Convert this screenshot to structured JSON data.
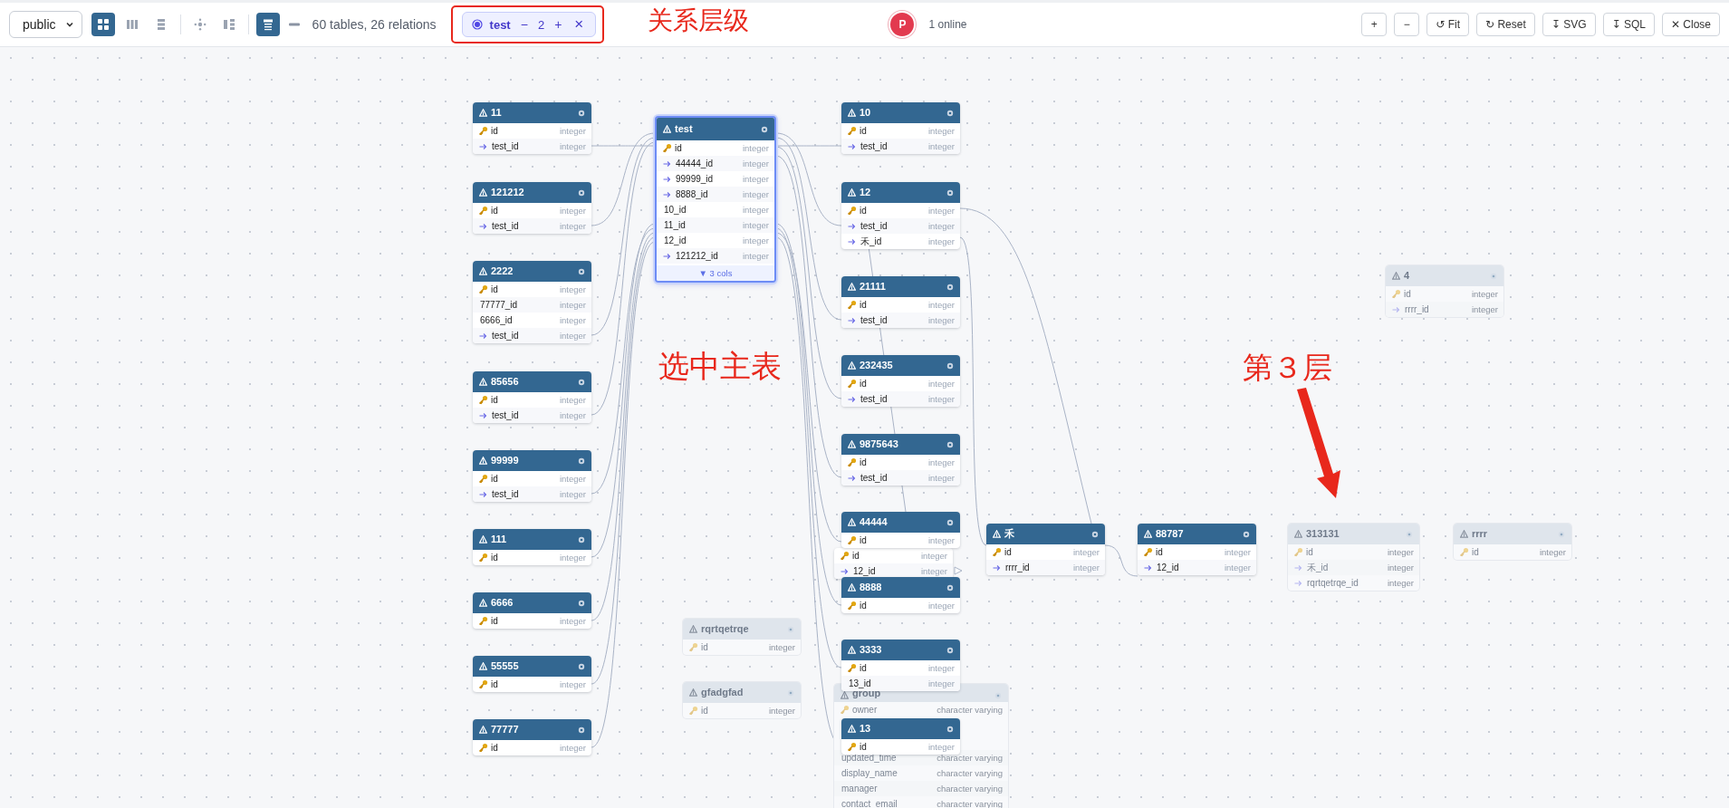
{
  "toolbar": {
    "schema": "public",
    "view_buttons": [
      {
        "kind": "grid",
        "selected": true
      },
      {
        "kind": "columns",
        "selected": false
      },
      {
        "kind": "rows",
        "selected": false
      },
      {
        "kind": "radial",
        "selected": false
      },
      {
        "kind": "tree",
        "selected": false
      }
    ],
    "focus_toggle": {
      "on": true
    },
    "summary": "60 tables, 26 relations",
    "focus_chip": {
      "table": "test",
      "minus": "−",
      "depth": "2",
      "plus": "+",
      "close": "×"
    },
    "presence": {
      "avatar": "P",
      "label": "1 online"
    },
    "actions": [
      "+",
      "−",
      "↺ Fit",
      "↻ Reset",
      "↧ SVG",
      "↧ SQL",
      "✕ Close"
    ]
  },
  "tables": [
    {
      "name": "11",
      "dimmed": false,
      "selected": false,
      "columns": [
        {
          "name": "id",
          "type": "integer",
          "kind": "pk"
        },
        {
          "name": "test_id",
          "type": "integer",
          "kind": "fk"
        }
      ]
    },
    {
      "name": "121212",
      "dimmed": false,
      "selected": false,
      "columns": [
        {
          "name": "id",
          "type": "integer",
          "kind": "pk"
        },
        {
          "name": "test_id",
          "type": "integer",
          "kind": "fk"
        }
      ]
    },
    {
      "name": "2222",
      "dimmed": false,
      "selected": false,
      "columns": [
        {
          "name": "id",
          "type": "integer",
          "kind": "pk"
        },
        {
          "name": "77777_id",
          "type": "integer",
          "kind": "plain"
        },
        {
          "name": "6666_id",
          "type": "integer",
          "kind": "plain"
        },
        {
          "name": "test_id",
          "type": "integer",
          "kind": "fk"
        }
      ]
    },
    {
      "name": "85656",
      "dimmed": false,
      "selected": false,
      "columns": [
        {
          "name": "id",
          "type": "integer",
          "kind": "pk"
        },
        {
          "name": "test_id",
          "type": "integer",
          "kind": "fk"
        }
      ]
    },
    {
      "name": "99999",
      "dimmed": false,
      "selected": false,
      "columns": [
        {
          "name": "id",
          "type": "integer",
          "kind": "pk"
        },
        {
          "name": "test_id",
          "type": "integer",
          "kind": "fk"
        }
      ]
    },
    {
      "name": "111",
      "dimmed": false,
      "selected": false,
      "columns": [
        {
          "name": "id",
          "type": "integer",
          "kind": "pk"
        }
      ]
    },
    {
      "name": "6666",
      "dimmed": false,
      "selected": false,
      "columns": [
        {
          "name": "id",
          "type": "integer",
          "kind": "pk"
        }
      ]
    },
    {
      "name": "55555",
      "dimmed": false,
      "selected": false,
      "columns": [
        {
          "name": "id",
          "type": "integer",
          "kind": "pk"
        }
      ]
    },
    {
      "name": "77777",
      "dimmed": false,
      "selected": false,
      "columns": [
        {
          "name": "id",
          "type": "integer",
          "kind": "pk"
        }
      ]
    },
    {
      "name": "test",
      "dimmed": false,
      "selected": true,
      "columns": [
        {
          "name": "id",
          "type": "integer",
          "kind": "pk"
        },
        {
          "name": "44444_id",
          "type": "integer",
          "kind": "fk"
        },
        {
          "name": "99999_id",
          "type": "integer",
          "kind": "fk"
        },
        {
          "name": "8888_id",
          "type": "integer",
          "kind": "fk"
        },
        {
          "name": "10_id",
          "type": "integer",
          "kind": "plain"
        },
        {
          "name": "11_id",
          "type": "integer",
          "kind": "plain"
        },
        {
          "name": "12_id",
          "type": "integer",
          "kind": "plain"
        },
        {
          "name": "121212_id",
          "type": "integer",
          "kind": "fk"
        }
      ],
      "more": "▼ 3 cols"
    },
    {
      "name": "10",
      "dimmed": false,
      "selected": false,
      "columns": [
        {
          "name": "id",
          "type": "integer",
          "kind": "pk"
        },
        {
          "name": "test_id",
          "type": "integer",
          "kind": "fk"
        }
      ]
    },
    {
      "name": "12",
      "dimmed": false,
      "selected": false,
      "columns": [
        {
          "name": "id",
          "type": "integer",
          "kind": "pk"
        },
        {
          "name": "test_id",
          "type": "integer",
          "kind": "fk"
        },
        {
          "name": "禾_id",
          "type": "integer",
          "kind": "fk"
        }
      ]
    },
    {
      "name": "21111",
      "dimmed": false,
      "selected": false,
      "columns": [
        {
          "name": "id",
          "type": "integer",
          "kind": "pk"
        },
        {
          "name": "test_id",
          "type": "integer",
          "kind": "fk"
        }
      ]
    },
    {
      "name": "232435",
      "dimmed": false,
      "selected": false,
      "columns": [
        {
          "name": "id",
          "type": "integer",
          "kind": "pk"
        },
        {
          "name": "test_id",
          "type": "integer",
          "kind": "fk"
        }
      ]
    },
    {
      "name": "9875643",
      "dimmed": false,
      "selected": false,
      "columns": [
        {
          "name": "id",
          "type": "integer",
          "kind": "pk"
        },
        {
          "name": "test_id",
          "type": "integer",
          "kind": "fk"
        }
      ]
    },
    {
      "name": "44444",
      "dimmed": false,
      "selected": false,
      "columns": [
        {
          "name": "id",
          "type": "integer",
          "kind": "pk"
        }
      ]
    },
    {
      "dimmed": false,
      "selected": false,
      "columns": [
        {
          "name": "id",
          "type": "integer",
          "kind": "pk"
        },
        {
          "name": "12_id",
          "type": "integer",
          "kind": "fk"
        }
      ]
    },
    {
      "name": "8888",
      "dimmed": false,
      "selected": false,
      "columns": [
        {
          "name": "id",
          "type": "integer",
          "kind": "pk"
        }
      ]
    },
    {
      "name": "3333",
      "dimmed": false,
      "selected": false,
      "columns": [
        {
          "name": "id",
          "type": "integer",
          "kind": "pk"
        },
        {
          "name": "13_id",
          "type": "integer",
          "kind": "plain"
        }
      ]
    },
    {
      "name": "group",
      "dimmed": true,
      "selected": false,
      "columns": [
        {
          "name": "owner",
          "type": "character varying",
          "kind": "pk"
        },
        {
          "name": "updated_time",
          "type": "character varying",
          "kind": "plain"
        },
        {
          "name": "display_name",
          "type": "character varying",
          "kind": "plain"
        },
        {
          "name": "manager",
          "type": "character varying",
          "kind": "plain"
        },
        {
          "name": "contact_email",
          "type": "character varying",
          "kind": "plain"
        }
      ]
    },
    {
      "name": "13",
      "dimmed": false,
      "selected": false,
      "columns": [
        {
          "name": "id",
          "type": "integer",
          "kind": "pk"
        }
      ]
    },
    {
      "name": "rqrtqetrqe",
      "dimmed": true,
      "selected": false,
      "columns": [
        {
          "name": "id",
          "type": "integer",
          "kind": "pk"
        }
      ]
    },
    {
      "name": "gfadgfad",
      "dimmed": true,
      "selected": false,
      "columns": [
        {
          "name": "id",
          "type": "integer",
          "kind": "pk"
        }
      ]
    },
    {
      "name": "禾",
      "dimmed": false,
      "selected": false,
      "columns": [
        {
          "name": "id",
          "type": "integer",
          "kind": "pk"
        },
        {
          "name": "rrrr_id",
          "type": "integer",
          "kind": "fk"
        }
      ]
    },
    {
      "name": "88787",
      "dimmed": false,
      "selected": false,
      "columns": [
        {
          "name": "id",
          "type": "integer",
          "kind": "pk"
        },
        {
          "name": "12_id",
          "type": "integer",
          "kind": "fk"
        }
      ]
    },
    {
      "name": "4",
      "dimmed": true,
      "selected": false,
      "columns": [
        {
          "name": "id",
          "type": "integer",
          "kind": "pk"
        },
        {
          "name": "rrrr_id",
          "type": "integer",
          "kind": "fk"
        }
      ]
    },
    {
      "name": "313131",
      "dimmed": true,
      "selected": false,
      "columns": [
        {
          "name": "id",
          "type": "integer",
          "kind": "pk"
        },
        {
          "name": "禾_id",
          "type": "integer",
          "kind": "fk"
        },
        {
          "name": "rqrtqetrqe_id",
          "type": "integer",
          "kind": "fk"
        }
      ]
    },
    {
      "name": "rrrr",
      "dimmed": true,
      "selected": false,
      "columns": [
        {
          "name": "id",
          "type": "integer",
          "kind": "pk"
        }
      ]
    }
  ],
  "annotations": [
    "关系层级",
    "选中主表",
    "第３层"
  ]
}
